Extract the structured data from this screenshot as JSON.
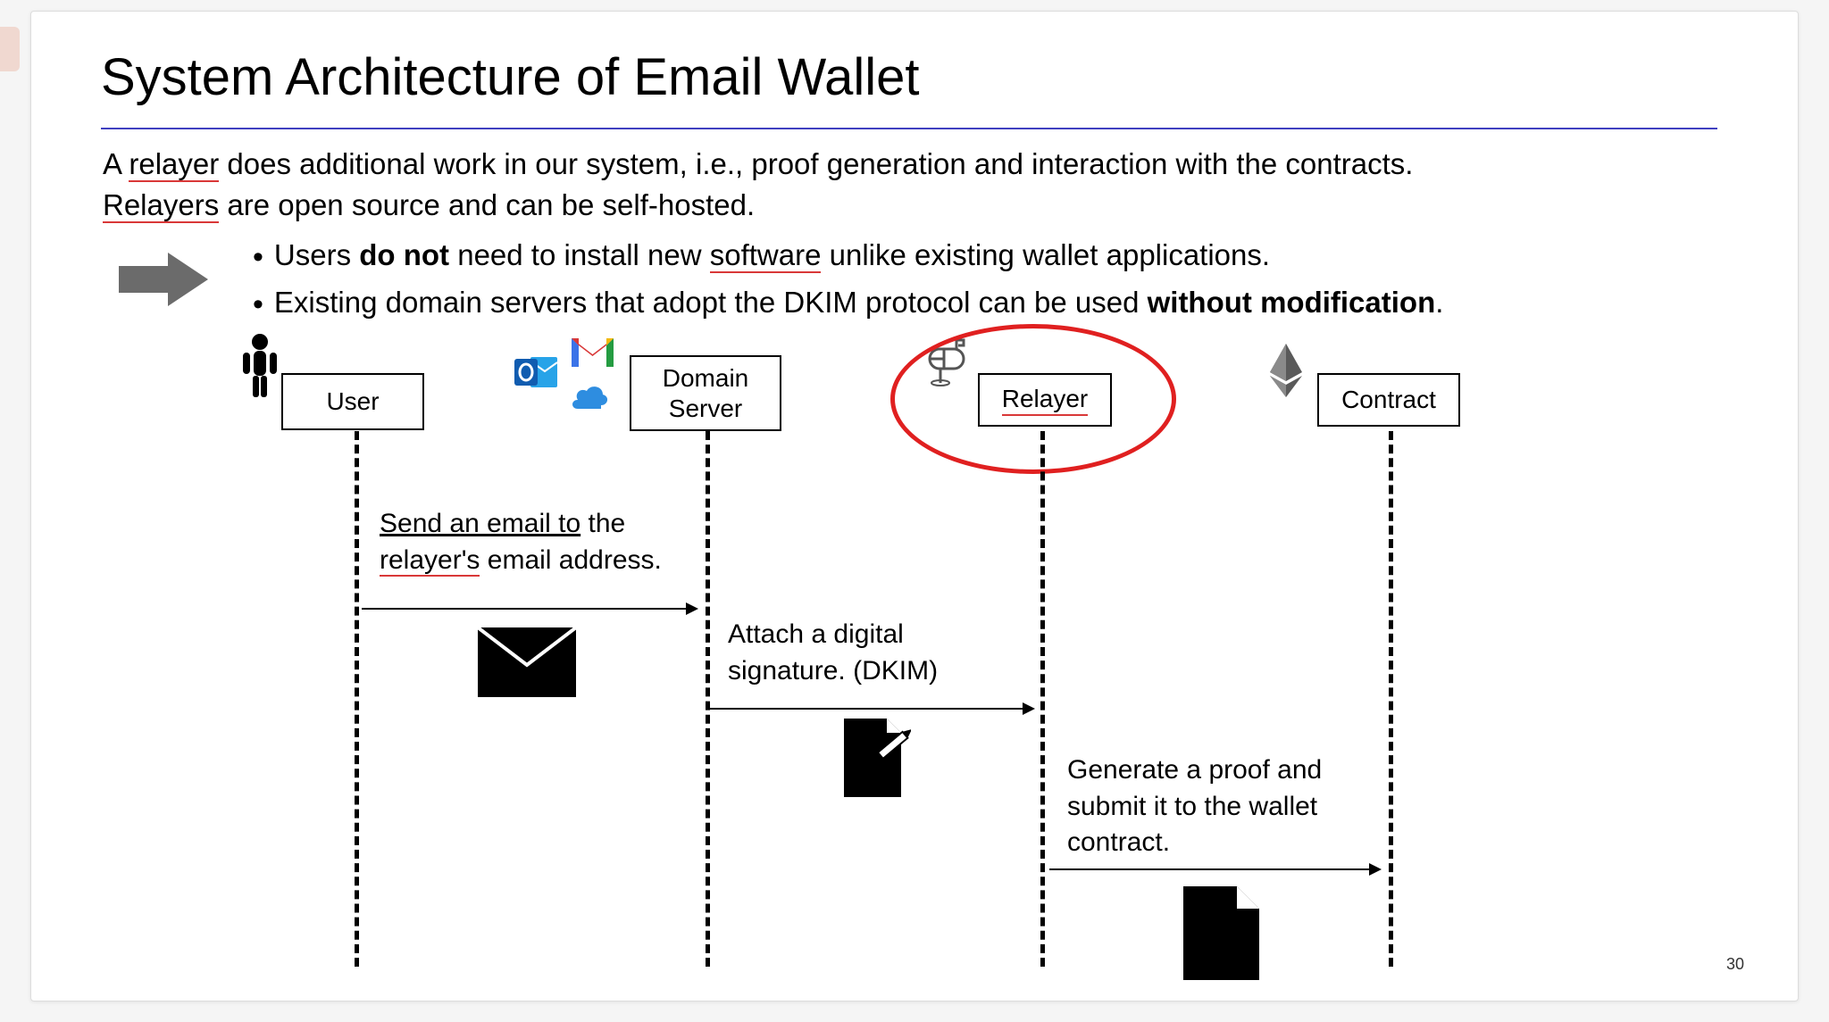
{
  "title": "System Architecture of Email Wallet",
  "subtitle": {
    "line_a_pre": "A ",
    "line_a_squig": "relayer",
    "line_a_post": " does additional work in our system, i.e., proof generation and interaction with the contracts.",
    "line_b_squig": "Relayers",
    "line_b_post": " are open source and can be self-hosted."
  },
  "bullets": {
    "b1_pre": "Users ",
    "b1_bold": "do not",
    "b1_mid": " need to install new ",
    "b1_squig": "software",
    "b1_post": " unlike existing wallet applications.",
    "b2_pre": "Existing domain servers that adopt the DKIM protocol can be used ",
    "b2_bold": "without modification",
    "b2_post": "."
  },
  "actors": {
    "user": "User",
    "domain": "Domain Server",
    "relayer": "Relayer",
    "contract": "Contract"
  },
  "messages": {
    "m1_u1": "Send an email to",
    "m1_rest_a": " the ",
    "m1_squig": "relayer's",
    "m1_rest_b": " email address.",
    "m2": "Attach a digital signature. (DKIM)",
    "m3": "Generate a proof and submit it to the wallet contract."
  },
  "page_number": "30"
}
